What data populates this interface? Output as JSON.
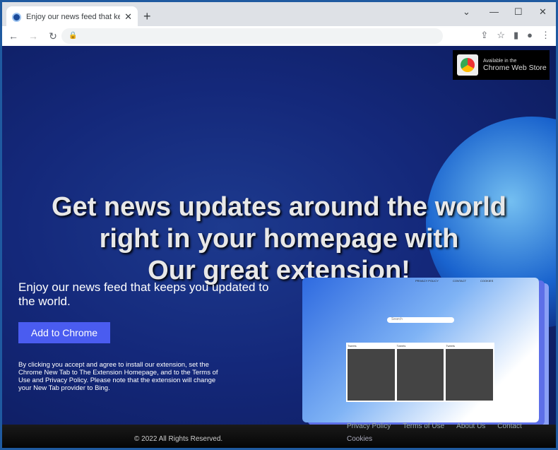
{
  "browser": {
    "tab_title": "Enjoy our news feed that keeps you updated to the world.",
    "new_tab": "+",
    "close": "✕",
    "url": ""
  },
  "page": {
    "badge": {
      "line1": "Available in the",
      "line2": "Chrome Web Store"
    },
    "headline": [
      "Get news updates around the world",
      "right in your homepage with",
      "Our great extension!"
    ],
    "subtitle": "Enjoy our news feed that keeps you updated to the world.",
    "cta": "Add to Chrome",
    "disclaimer": "By clicking you accept and agree to install our extension, set the Chrome New Tab to The Extension Homepage, and to the Terms of Use and Privacy Policy. Please note that the extension will change your New Tab provider to Bing.",
    "preview": {
      "nav": [
        "PRIVACY POLICY",
        "CONTACT",
        "COOKIES"
      ],
      "search": "Search",
      "tweets": [
        "Tweets",
        "Tweets",
        "Tweets"
      ]
    },
    "footer": {
      "copyright": "© 2022 All Rights Reserved.",
      "links": [
        "Privacy Policy",
        "Terms of Use",
        "About Us",
        "Contact"
      ],
      "cookies": "Cookies"
    }
  }
}
